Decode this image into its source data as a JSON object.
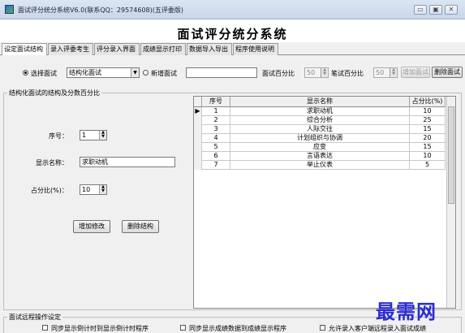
{
  "window": {
    "title": "面试评分统分系统V6.0(联系QQ：29574608)(五评委版)",
    "buttons": [
      "▭",
      "▣",
      "✕"
    ]
  },
  "app_title": "面试评分统分系统",
  "tabs": [
    {
      "label": "设定面试结构",
      "active": true
    },
    {
      "label": "录入评委考生",
      "active": false
    },
    {
      "label": "评分录入界面",
      "active": false
    },
    {
      "label": "成绩显示打印",
      "active": false
    },
    {
      "label": "数据导入导出",
      "active": false
    },
    {
      "label": "程序使用说明",
      "active": false
    }
  ],
  "toolbar": {
    "select_interview_label": "选择面试",
    "select_interview_value": "结构化面试",
    "new_interview_label": "新增面试",
    "new_interview_value": "",
    "interview_pct_label": "面试百分比",
    "interview_pct_value": "50",
    "written_pct_label": "笔试百分比",
    "written_pct_value": "50",
    "add_button": "增加面试",
    "delete_button": "删除面试"
  },
  "structure_group": {
    "title": "结构化面试的结构及分数百分比",
    "seq_label": "序号：",
    "seq_value": "1",
    "name_label": "显示名称：",
    "name_value": "求职动机",
    "pct_label": "占分比(%)：",
    "pct_value": "10",
    "add_modify_button": "增加修改",
    "delete_structure_button": "删除结构"
  },
  "grid": {
    "columns": [
      "序号",
      "显示名称",
      "占分比(%)"
    ],
    "rows": [
      {
        "seq": "1",
        "name": "求职动机",
        "pct": "10"
      },
      {
        "seq": "2",
        "name": "综合分析",
        "pct": "25"
      },
      {
        "seq": "3",
        "name": "人际交往",
        "pct": "15"
      },
      {
        "seq": "4",
        "name": "计划组织与协调",
        "pct": "20"
      },
      {
        "seq": "5",
        "name": "应变",
        "pct": "15"
      },
      {
        "seq": "6",
        "name": "言语表达",
        "pct": "10"
      },
      {
        "seq": "7",
        "name": "举止仪表",
        "pct": "5"
      }
    ],
    "selected_row_marker": "▶"
  },
  "remote_group": {
    "title": "面试远程操作设定",
    "options": [
      "同步显示倒计时到显示倒计时程序",
      "同步显示成绩数据到成绩显示程序",
      "允许录入客户端远程录入面试成绩"
    ]
  },
  "watermark": "最需网"
}
